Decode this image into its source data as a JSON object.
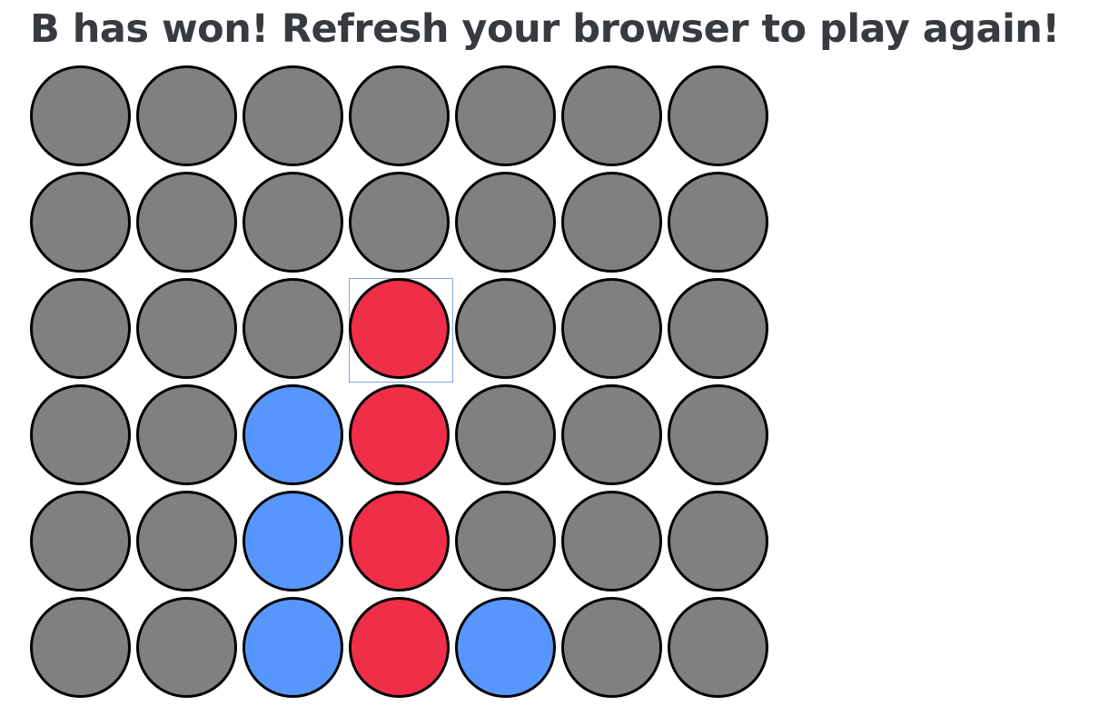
{
  "status": {
    "message": "B has won! Refresh your browser to play again!"
  },
  "colors": {
    "empty": "#808080",
    "player_a": "#ef2e48",
    "player_b": "#5797fd",
    "focus_outline": "#7aa7ea"
  },
  "board": {
    "rows": 6,
    "columns": 7,
    "focused_cell": {
      "row": 3,
      "column": 4
    },
    "cells": [
      [
        "empty",
        "empty",
        "empty",
        "empty",
        "empty",
        "empty",
        "empty"
      ],
      [
        "empty",
        "empty",
        "empty",
        "empty",
        "empty",
        "empty",
        "empty"
      ],
      [
        "empty",
        "empty",
        "empty",
        "player_a",
        "empty",
        "empty",
        "empty"
      ],
      [
        "empty",
        "empty",
        "player_b",
        "player_a",
        "empty",
        "empty",
        "empty"
      ],
      [
        "empty",
        "empty",
        "player_b",
        "player_a",
        "empty",
        "empty",
        "empty"
      ],
      [
        "empty",
        "empty",
        "player_b",
        "player_a",
        "player_b",
        "empty",
        "empty"
      ]
    ]
  }
}
